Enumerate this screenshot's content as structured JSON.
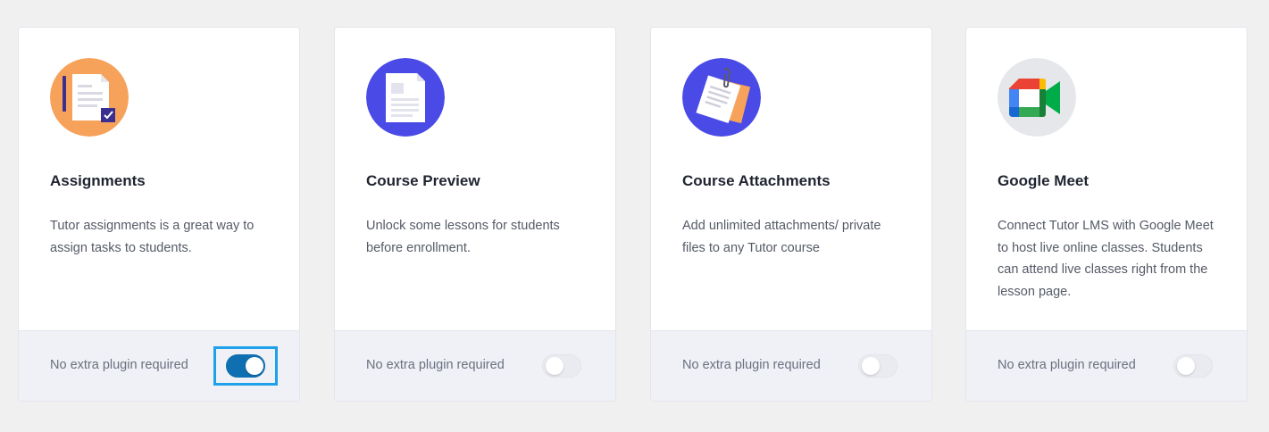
{
  "cards": [
    {
      "icon": "assignment-document-icon",
      "title": "Assignments",
      "description": "Tutor assignments is a great way to assign tasks to students.",
      "footer_label": "No extra plugin required",
      "enabled": true,
      "icon_bg": "#f7a25b"
    },
    {
      "icon": "course-preview-document-icon",
      "title": "Course Preview",
      "description": "Unlock some lessons for students before enrollment.",
      "footer_label": "No extra plugin required",
      "enabled": false,
      "icon_bg": "#4a4ae6"
    },
    {
      "icon": "attachment-paperclip-icon",
      "title": "Course Attachments",
      "description": "Add unlimited attachments/ private files to any Tutor course",
      "footer_label": "No extra plugin required",
      "enabled": false,
      "icon_bg": "#4a4ae6"
    },
    {
      "icon": "google-meet-icon",
      "title": "Google Meet",
      "description": "Connect Tutor LMS with Google Meet to host live online classes. Students can attend live classes right from the lesson page.",
      "footer_label": "No extra plugin required",
      "enabled": false,
      "icon_bg": "#e5e7ea"
    }
  ],
  "colors": {
    "page_bg": "#f0f0f1",
    "toggle_on": "#0f6fb0",
    "highlight_border": "#1ea1e8"
  }
}
